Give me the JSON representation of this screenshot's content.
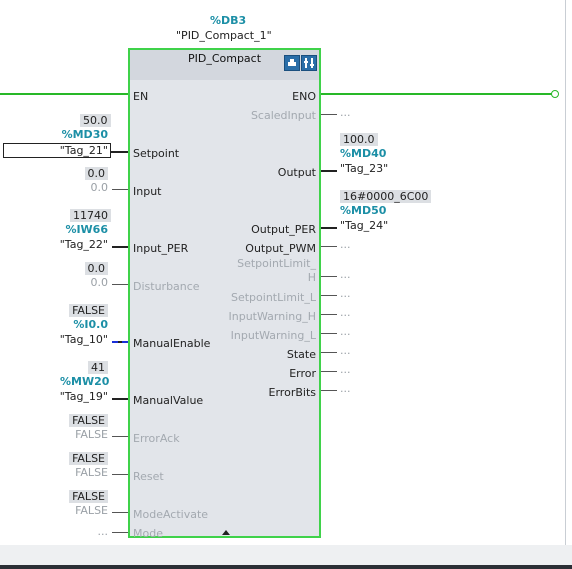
{
  "instance": {
    "db": "%DB3",
    "name": "\"PID_Compact_1\""
  },
  "block": {
    "title": "PID_Compact"
  },
  "left_pins": [
    {
      "name": "EN",
      "active": true
    },
    {
      "name": "Setpoint",
      "active": true
    },
    {
      "name": "Input",
      "active": true
    },
    {
      "name": "Input_PER",
      "active": true
    },
    {
      "name": "Disturbance",
      "active": false
    },
    {
      "name": "ManualEnable",
      "active": true
    },
    {
      "name": "ManualValue",
      "active": true
    },
    {
      "name": "ErrorAck",
      "active": false
    },
    {
      "name": "Reset",
      "active": false
    },
    {
      "name": "ModeActivate",
      "active": false
    },
    {
      "name": "Mode",
      "active": false
    }
  ],
  "right_pins": [
    {
      "name": "ENO",
      "active": true
    },
    {
      "name": "ScaledInput",
      "active": false
    },
    {
      "name": "Output",
      "active": true
    },
    {
      "name": "Output_PER",
      "active": true
    },
    {
      "name": "Output_PWM",
      "active": true
    },
    {
      "name": "SetpointLimit_",
      "active": false
    },
    {
      "name": "H",
      "active": false
    },
    {
      "name": "SetpointLimit_L",
      "active": false
    },
    {
      "name": "InputWarning_H",
      "active": false
    },
    {
      "name": "InputWarning_L",
      "active": false
    },
    {
      "name": "State",
      "active": true
    },
    {
      "name": "Error",
      "active": true
    },
    {
      "name": "ErrorBits",
      "active": true
    }
  ],
  "inputs": {
    "setpoint": {
      "value": "50.0",
      "address": "%MD30",
      "tag": "\"Tag_21\""
    },
    "input": {
      "value": "0.0",
      "ghost": "0.0"
    },
    "input_per": {
      "value": "11740",
      "address": "%IW66",
      "tag": "\"Tag_22\""
    },
    "disturbance": {
      "value": "0.0",
      "ghost": "0.0"
    },
    "manual_enable": {
      "value": "FALSE",
      "address": "%I0.0",
      "tag": "\"Tag_10\""
    },
    "manual_value": {
      "value": "41",
      "address": "%MW20",
      "tag": "\"Tag_19\""
    },
    "error_ack": {
      "value": "FALSE",
      "ghost": "FALSE"
    },
    "reset": {
      "value": "FALSE",
      "ghost": "FALSE"
    },
    "mode_activate": {
      "value": "FALSE",
      "ghost": "FALSE"
    },
    "mode": {
      "ghost": "..."
    }
  },
  "outputs": {
    "output": {
      "value": "100.0",
      "address": "%MD40",
      "tag": "\"Tag_23\""
    },
    "output_per": {
      "value": "16#0000_6C00",
      "address": "%MD50",
      "tag": "\"Tag_24\""
    },
    "unconnected": "..."
  }
}
